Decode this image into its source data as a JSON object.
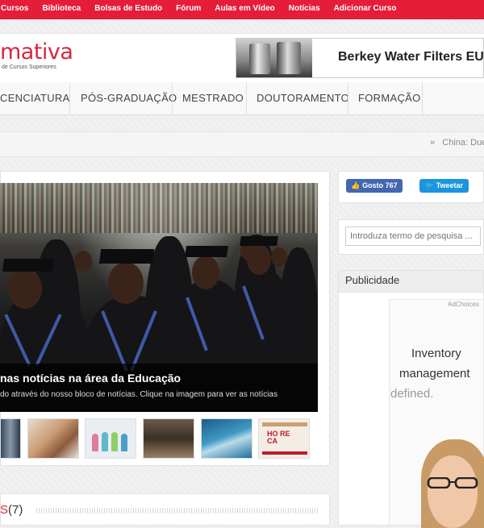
{
  "topnav": [
    "Cursos",
    "Biblioteca",
    "Bolsas de Estudo",
    "Fórum",
    "Aulas em Vídeo",
    "Notícias",
    "Adicionar Curso"
  ],
  "logo": {
    "word": "mativa",
    "tagline": "de Cursos Superiores"
  },
  "banner_ad": {
    "title": "Berkey Water Filters EU"
  },
  "mainnav": [
    "CENCIATURA",
    "PÓS-GRADUAÇÃO",
    "MESTRADO",
    "DOUTORAMENTO",
    "FORMAÇÃO"
  ],
  "breadcrumb": {
    "sep": "»",
    "text": "China: Duel"
  },
  "slider": {
    "title": "nas notícias na área da Educação",
    "text": "do através do nosso bloco de notícias. Clique na imagem para ver as notícias"
  },
  "thumb_text": {
    "t6a": "HO",
    "t6b": "RE",
    "t6c": "CA"
  },
  "latest": {
    "label": "S",
    "count": "(7)"
  },
  "social": {
    "like_label": "Gosto",
    "like_count": "767",
    "tweet_label": "Tweetar"
  },
  "search": {
    "placeholder": "Introduza termo de pesquisa ..."
  },
  "sidebar": {
    "publicidade": "Publicidade"
  },
  "side_ad": {
    "adchoices": "AdChoices",
    "line1": "Inventory",
    "line2": "management",
    "line3": "defined."
  },
  "colors": {
    "brand_red": "#e61d38",
    "facebook": "#4267b2",
    "twitter": "#1b95e0"
  }
}
